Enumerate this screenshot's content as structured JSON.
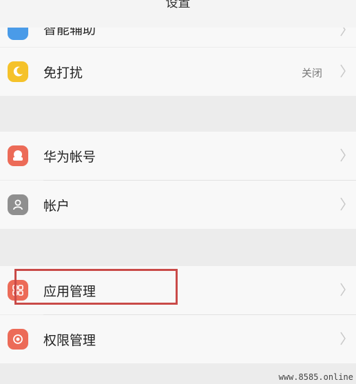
{
  "header": {
    "title": "设置"
  },
  "rows": {
    "partial": {
      "label": "智能辅助"
    },
    "dnd": {
      "label": "免打扰",
      "value": "关闭",
      "icon": "moon-icon",
      "color": "#f5c22a"
    },
    "huawei_account": {
      "label": "华为帐号",
      "icon": "huawei-account-icon",
      "color": "#ec6b58"
    },
    "accounts": {
      "label": "帐户",
      "icon": "person-icon",
      "color": "#8f8f8f"
    },
    "app_manager": {
      "label": "应用管理",
      "icon": "apps-icon",
      "color": "#ec6b58"
    },
    "permissions": {
      "label": "权限管理",
      "icon": "permission-icon",
      "color": "#ec6b58"
    }
  },
  "watermark": "www.8585.online"
}
